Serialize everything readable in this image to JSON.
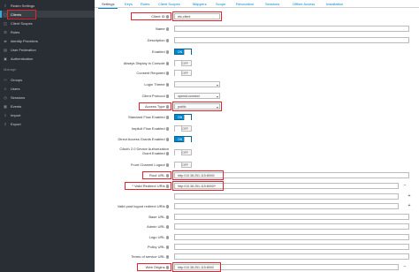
{
  "sidebar": {
    "items_top": [
      {
        "label": "Realm Settings",
        "icon": "sliders-icon"
      },
      {
        "label": "Clients",
        "icon": "cube-icon"
      },
      {
        "label": "Client Scopes",
        "icon": "cubes-icon"
      },
      {
        "label": "Roles",
        "icon": "list-icon"
      },
      {
        "label": "Identity Providers",
        "icon": "exchange-icon"
      },
      {
        "label": "User Federation",
        "icon": "database-icon"
      },
      {
        "label": "Authentication",
        "icon": "lock-icon"
      }
    ],
    "section": "Manage",
    "items_manage": [
      {
        "label": "Groups",
        "icon": "users-icon"
      },
      {
        "label": "Users",
        "icon": "user-icon"
      },
      {
        "label": "Sessions",
        "icon": "clock-icon"
      },
      {
        "label": "Events",
        "icon": "calendar-icon"
      },
      {
        "label": "Import",
        "icon": "import-icon"
      },
      {
        "label": "Export",
        "icon": "export-icon"
      }
    ]
  },
  "tabs": [
    "Settings",
    "Keys",
    "Roles",
    "Client Scopes",
    "Mappers",
    "Scope",
    "Revocation",
    "Sessions",
    "Offline Access",
    "Installation"
  ],
  "form": {
    "client_id": {
      "label": "Client ID",
      "value": "etc-client"
    },
    "name": {
      "label": "Name",
      "value": ""
    },
    "description": {
      "label": "Description",
      "value": ""
    },
    "enabled": {
      "label": "Enabled",
      "state": "ON"
    },
    "always_display": {
      "label": "Always Display in Console",
      "state": "OFF"
    },
    "consent_required": {
      "label": "Consent Required",
      "state": "OFF"
    },
    "login_theme": {
      "label": "Login Theme",
      "value": ""
    },
    "client_protocol": {
      "label": "Client Protocol",
      "value": "openid-connect"
    },
    "access_type": {
      "label": "Access Type",
      "value": "public"
    },
    "standard_flow": {
      "label": "Standard Flow Enabled",
      "state": "ON"
    },
    "implicit_flow": {
      "label": "Implicit Flow Enabled",
      "state": "OFF"
    },
    "direct_access": {
      "label": "Direct Access Grants Enabled",
      "state": "ON"
    },
    "oauth_device": {
      "label": "OAuth 2.0 Device Authorization Grant Enabled",
      "state": "OFF"
    },
    "front_channel": {
      "label": "Front Channel Logout",
      "state": "OFF"
    },
    "root_url": {
      "label": "Root URL",
      "value": "http://10.38.251.115:8000/"
    },
    "redirect_uris": {
      "label": "* Valid Redirect URIs",
      "value": "http://10.38.251.115:8000/*"
    },
    "post_logout": {
      "label": "Valid post logout redirect URIs",
      "value": ""
    },
    "base_url": {
      "label": "Base URL",
      "value": ""
    },
    "admin_url": {
      "label": "Admin URL",
      "value": ""
    },
    "logo_url": {
      "label": "Logo URL",
      "value": ""
    },
    "policy_url": {
      "label": "Policy URL",
      "value": ""
    },
    "tos_url": {
      "label": "Terms of service URL",
      "value": ""
    },
    "web_origins": {
      "label": "Web Origins",
      "value": "http://10.38.251.115:8000"
    }
  },
  "colors": {
    "accent": "#0088ce",
    "highlight": "#e5232f",
    "sidebar": "#292e34"
  }
}
